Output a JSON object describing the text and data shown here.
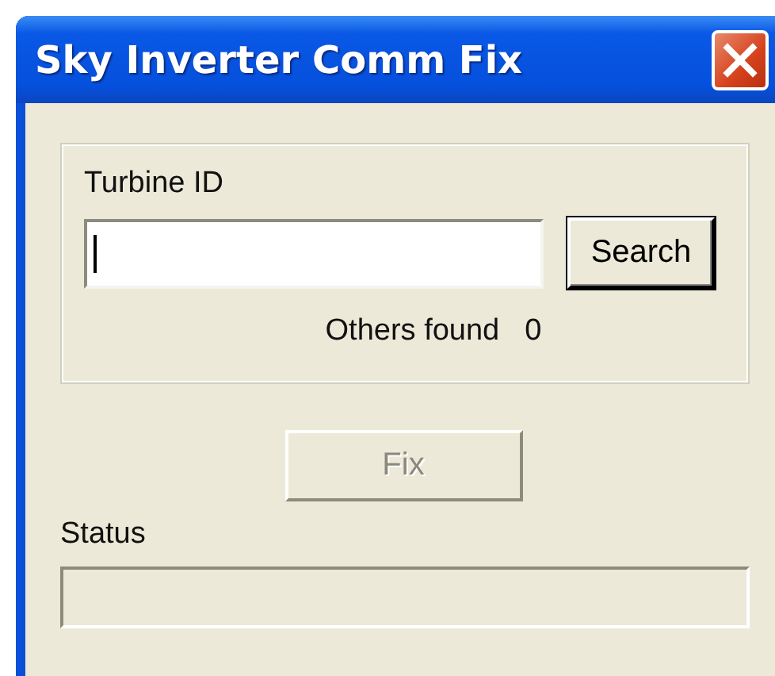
{
  "window": {
    "title": "Sky Inverter Comm Fix"
  },
  "turbine_group": {
    "label": "Turbine ID",
    "field": {
      "focused": true
    },
    "search_button": {
      "label": "Search"
    },
    "others_found": {
      "label": "Others found",
      "count": "0"
    }
  },
  "fix_button": {
    "label": "Fix",
    "disabled": true
  },
  "status": {
    "label": "Status"
  }
}
